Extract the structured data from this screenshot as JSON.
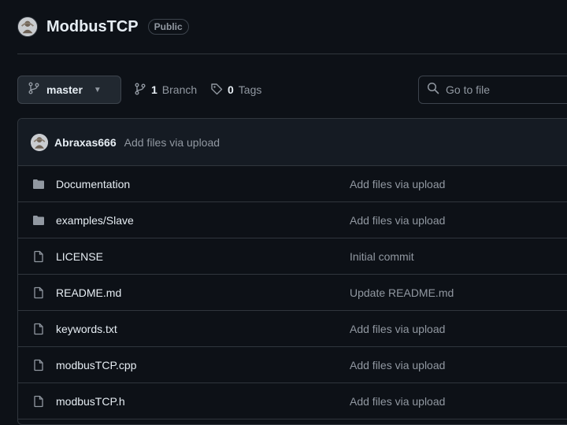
{
  "repo": {
    "name": "ModbusTCP",
    "visibility": "Public"
  },
  "toolbar": {
    "branch_label": "master",
    "branch_count": "1",
    "branch_word": "Branch",
    "tag_count": "0",
    "tag_word": "Tags",
    "search_placeholder": "Go to file"
  },
  "latest_commit": {
    "author": "Abraxas666",
    "message": "Add files via upload"
  },
  "files": [
    {
      "name": "Documentation",
      "type": "folder",
      "commit": "Add files via upload"
    },
    {
      "name": "examples/Slave",
      "type": "folder",
      "commit": "Add files via upload"
    },
    {
      "name": "LICENSE",
      "type": "file",
      "commit": "Initial commit"
    },
    {
      "name": "README.md",
      "type": "file",
      "commit": "Update README.md"
    },
    {
      "name": "keywords.txt",
      "type": "file",
      "commit": "Add files via upload"
    },
    {
      "name": "modbusTCP.cpp",
      "type": "file",
      "commit": "Add files via upload"
    },
    {
      "name": "modbusTCP.h",
      "type": "file",
      "commit": "Add files via upload"
    }
  ],
  "colors": {
    "background": "#0d1117",
    "border": "#30363d",
    "text": "#e6edf3",
    "muted": "#9198a1",
    "folder_icon": "#9198a1"
  }
}
